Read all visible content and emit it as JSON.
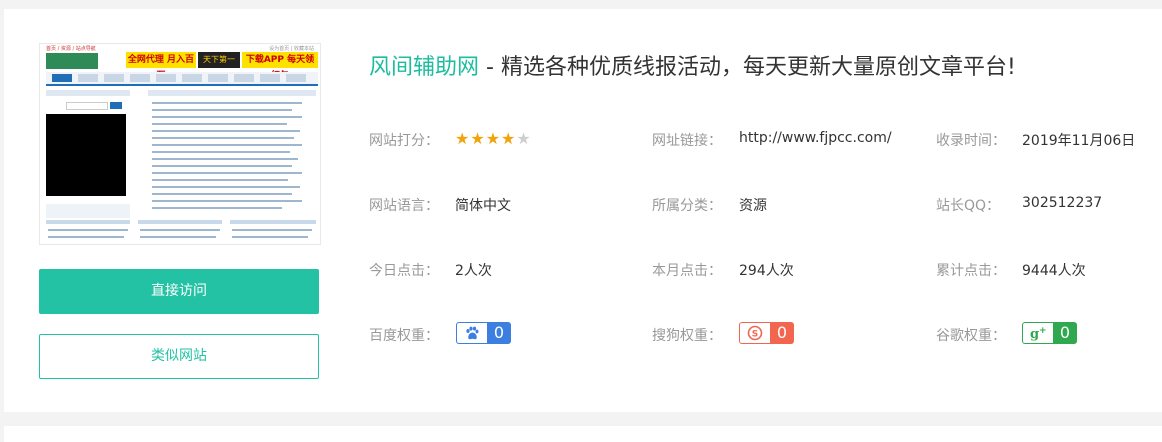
{
  "site": {
    "name": "风间辅助网",
    "tagline": " - 精选各种优质线报活动，每天更新大量原创文章平台!"
  },
  "thumbnail": {
    "crumb": "首页 / 资源 / 站点导航",
    "toplinks": "设为首页 | 收藏本站",
    "ad_left": "全网代理 月入百万",
    "ad_mid": "天下第一",
    "ad_right": "下载APP 每天领红包"
  },
  "buttons": {
    "visit": "直接访问",
    "similar": "类似网站"
  },
  "info": {
    "rating_label": "网站打分：",
    "rating_value": 4,
    "rating_max": 5,
    "url_label": "网址链接：",
    "url_value": "http://www.fjpcc.com/",
    "date_label": "收录时间：",
    "date_value": "2019年11月06日",
    "lang_label": "网站语言：",
    "lang_value": "简体中文",
    "category_label": "所属分类：",
    "category_value": "资源",
    "qq_label": "站长QQ：",
    "qq_value": "302512237",
    "today_label": "今日点击：",
    "today_value": "2人次",
    "month_label": "本月点击：",
    "month_value": "294人次",
    "total_label": "累计点击：",
    "total_value": "9444人次",
    "baidu_label": "百度权重：",
    "baidu_value": "0",
    "sogou_label": "搜狗权重：",
    "sogou_value": "0",
    "google_label": "谷歌权重：",
    "google_value": "0"
  },
  "colors": {
    "accent": "#24c2a4",
    "star": "#f0a30a",
    "baidu": "#3d7fe0",
    "sogou": "#f26650",
    "google": "#2fa84f"
  }
}
